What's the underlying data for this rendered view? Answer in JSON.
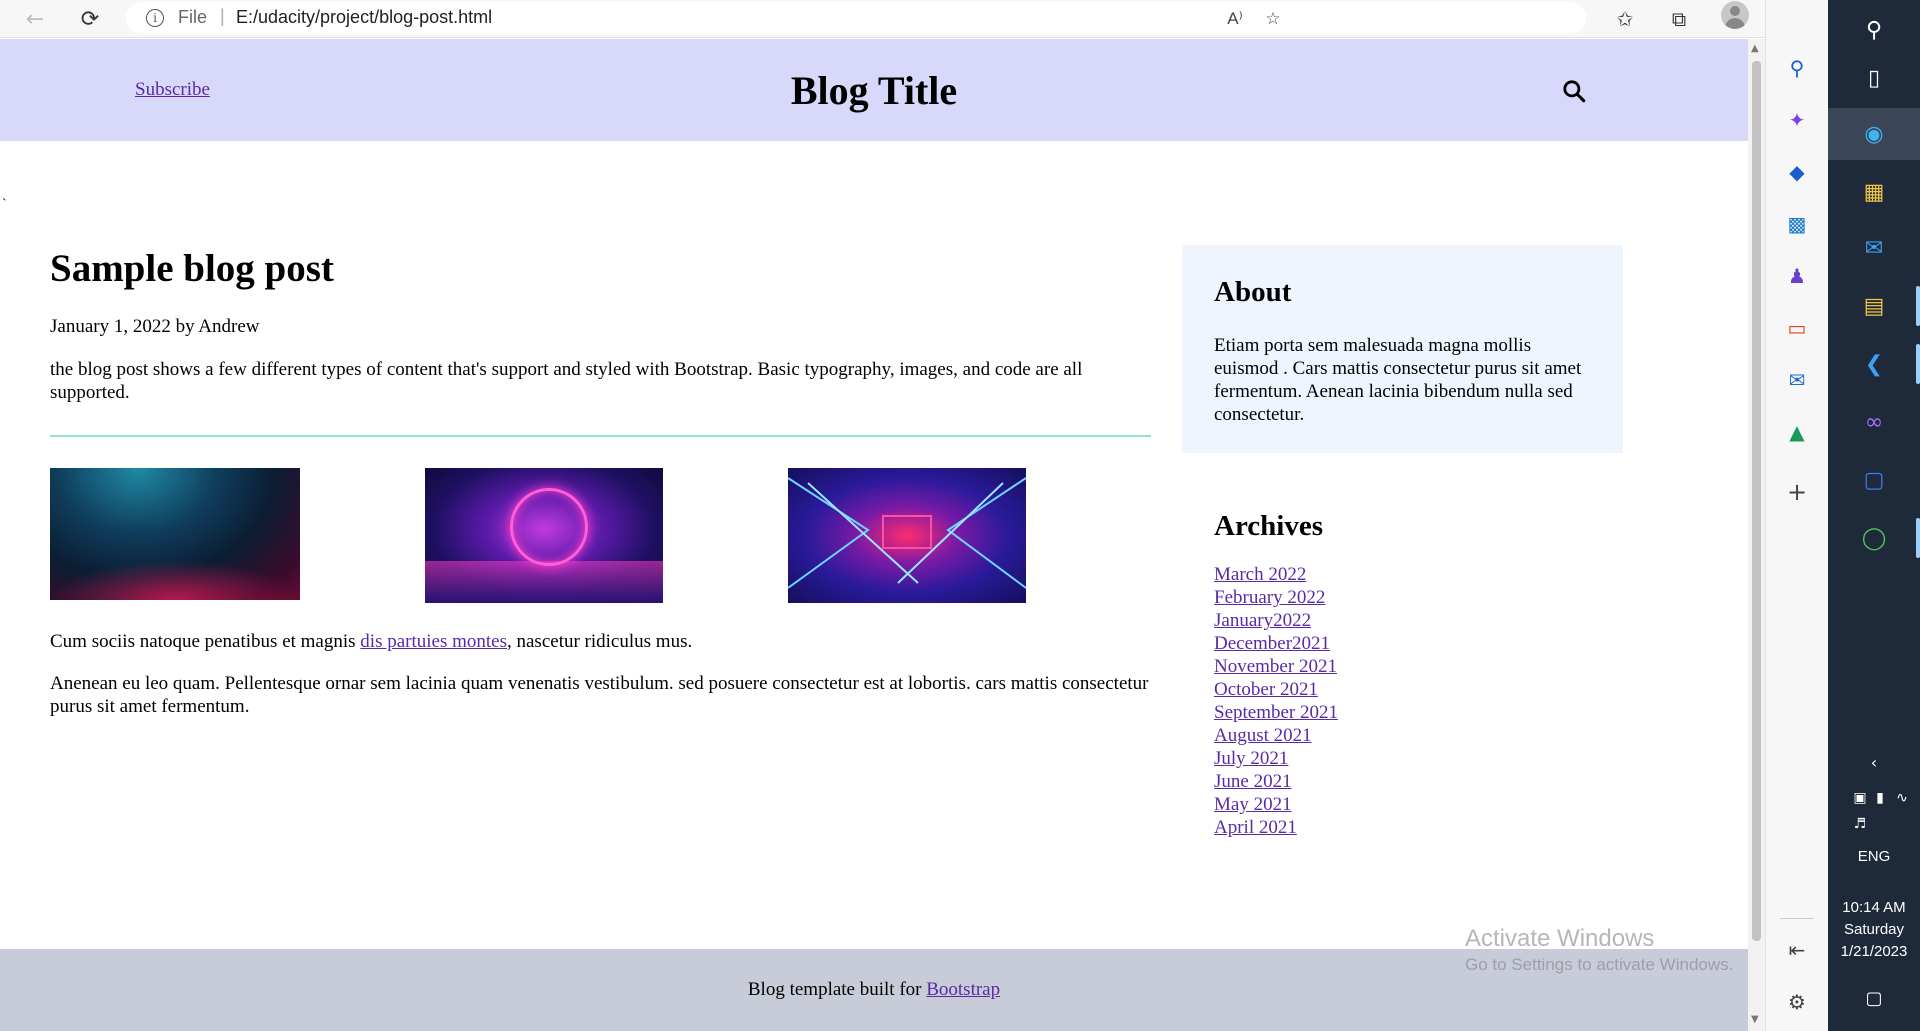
{
  "browser": {
    "file_label": "File",
    "url": "E:/udacity/project/blog-post.html",
    "read_aloud_label": "A⁾"
  },
  "site": {
    "subscribe": "Subscribe",
    "title": "Blog Title"
  },
  "stray_mark": "`",
  "post": {
    "title": "Sample blog post",
    "meta": "January 1, 2022 by Andrew",
    "intro": "the blog post shows a few different types of content that's support and styled with Bootstrap. Basic typography, images, and code are all supported.",
    "para1_before": "Cum sociis natoque penatibus et magnis ",
    "para1_link": "dis partuies montes",
    "para1_after": ", nascetur ridiculus mus.",
    "para2": "Anenean eu leo quam. Pellentesque ornar sem lacinia quam venenatis vestibulum. sed posuere consectetur est at lobortis. cars mattis consectetur purus sit amet fermentum."
  },
  "sidebar": {
    "about_heading": "About",
    "about_text": "Etiam porta sem malesuada magna mollis euismod . Cars mattis consectetur purus sit amet fermentum. Aenean lacinia bibendum nulla sed consectetur.",
    "archives_heading": "Archives",
    "archives": [
      "March 2022",
      "February 2022",
      "January2022",
      "December2021",
      "November 2021",
      "October 2021",
      "September 2021",
      "August 2021",
      "July 2021",
      "June 2021",
      "May 2021",
      "April 2021"
    ]
  },
  "footer": {
    "text": "Blog template built for ",
    "link": "Bootstrap"
  },
  "watermark": {
    "title": "Activate Windows",
    "subtitle": "Go to Settings to activate Windows."
  },
  "taskbar": {
    "language": "ENG",
    "time": "10:14 AM",
    "day": "Saturday",
    "date": "1/21/2023"
  },
  "colors": {
    "header_bg": "#d8d8fb",
    "about_bg": "#eef5fe",
    "footer_bg": "#c8ccd8",
    "link": "#5a2aa6",
    "divider": "#8fe3c6"
  }
}
